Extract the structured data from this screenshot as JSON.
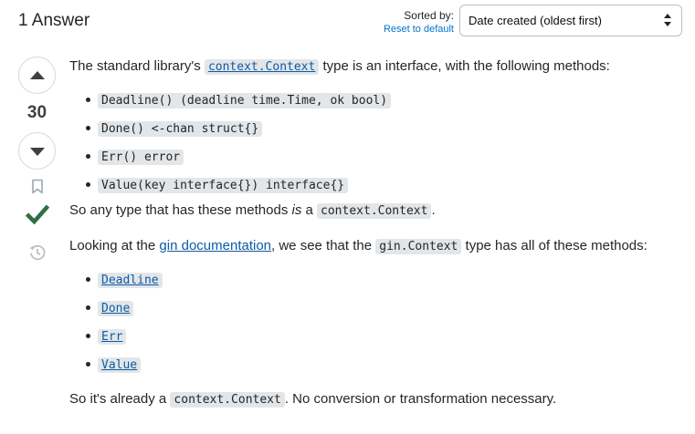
{
  "header": {
    "answers_count": "1 Answer",
    "sorted_by_label": "Sorted by:",
    "reset_link": "Reset to default",
    "sort_selected": "Date created (oldest first)"
  },
  "votes": {
    "score": "30",
    "accepted": true,
    "icons": [
      "arrow-up-icon",
      "arrow-down-icon",
      "bookmark-icon",
      "checkmark-icon",
      "history-icon"
    ]
  },
  "answer": {
    "p1": {
      "before": "The standard library's ",
      "code": "context.Context",
      "after": " type is an interface, with the following methods:"
    },
    "methods": [
      "Deadline() (deadline time.Time, ok bool)",
      "Done() <-chan struct{}",
      "Err() error",
      "Value(key interface{}) interface{}"
    ],
    "p2": {
      "before": "So any type that has these methods ",
      "em": "is",
      "middle": " a ",
      "code": "context.Context",
      "after": "."
    },
    "p3": {
      "before": "Looking at the ",
      "link": "gin documentation",
      "middle": ", we see that the ",
      "code": "gin.Context",
      "after": " type has all of these methods:"
    },
    "gin_methods": [
      "Deadline",
      "Done",
      "Err",
      "Value"
    ],
    "p4": {
      "before": "So it's already a ",
      "code": "context.Context",
      "after": ". No conversion or transformation necessary."
    }
  },
  "colors": {
    "accent_link": "#0074cc",
    "accepted_check": "#2f6f44",
    "code_bg": "#e3e6e8"
  }
}
